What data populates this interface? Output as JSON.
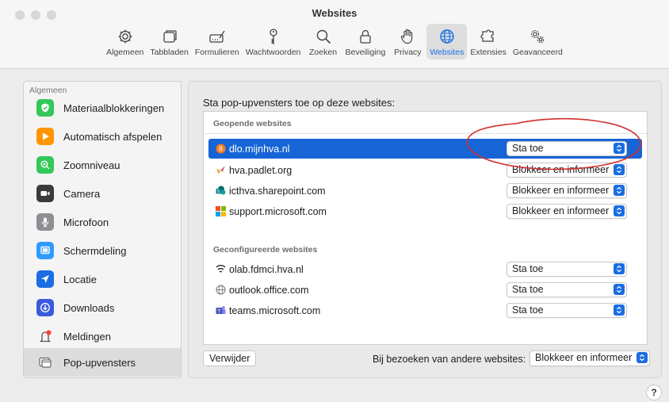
{
  "window": {
    "title": "Websites"
  },
  "toolbar": {
    "items": [
      {
        "label": "Algemeen",
        "icon": "gear-icon"
      },
      {
        "label": "Tabbladen",
        "icon": "tabs-icon"
      },
      {
        "label": "Formulieren",
        "icon": "form-icon"
      },
      {
        "label": "Wachtwoorden",
        "icon": "key-icon"
      },
      {
        "label": "Zoeken",
        "icon": "search-icon"
      },
      {
        "label": "Beveiliging",
        "icon": "lock-icon"
      },
      {
        "label": "Privacy",
        "icon": "hand-icon"
      },
      {
        "label": "Websites",
        "icon": "globe-icon",
        "active": true
      },
      {
        "label": "Extensies",
        "icon": "puzzle-icon"
      },
      {
        "label": "Geavanceerd",
        "icon": "gears-icon"
      }
    ]
  },
  "sidebar": {
    "header": "Algemeen",
    "items": [
      {
        "label": "Materiaalblokkeringen",
        "icon": "content-blocker-icon",
        "color": "#34c759"
      },
      {
        "label": "Automatisch afspelen",
        "icon": "play-icon",
        "color": "#ff9500"
      },
      {
        "label": "Zoomniveau",
        "icon": "zoom-icon",
        "color": "#34c759"
      },
      {
        "label": "Camera",
        "icon": "camera-icon",
        "color": "#3a3a3c"
      },
      {
        "label": "Microfoon",
        "icon": "microphone-icon",
        "color": "#8e8e93"
      },
      {
        "label": "Schermdeling",
        "icon": "screen-share-icon",
        "color": "#2f9bff"
      },
      {
        "label": "Locatie",
        "icon": "location-icon",
        "color": "#1a6de3"
      },
      {
        "label": "Downloads",
        "icon": "download-icon",
        "color": "#3b5bdb"
      },
      {
        "label": "Meldingen",
        "icon": "notification-icon",
        "color": "#ff3b30"
      },
      {
        "label": "Pop-upvensters",
        "icon": "popup-window-icon",
        "color": "#8e8e93",
        "selected": true
      }
    ]
  },
  "main": {
    "heading": "Sta pop-upvensters toe op deze websites:",
    "open_header": "Geopende websites",
    "open_sites": [
      {
        "name": "dlo.mijnhva.nl",
        "setting": "Sta toe",
        "icon": "brightspace-icon",
        "selected": true
      },
      {
        "name": "hva.padlet.org",
        "setting": "Blokkeer en informeer",
        "icon": "padlet-icon"
      },
      {
        "name": "icthva.sharepoint.com",
        "setting": "Blokkeer en informeer",
        "icon": "sharepoint-icon"
      },
      {
        "name": "support.microsoft.com",
        "setting": "Blokkeer en informeer",
        "icon": "microsoft-icon"
      }
    ],
    "configured_header": "Geconfigureerde websites",
    "configured_sites": [
      {
        "name": "olab.fdmci.hva.nl",
        "setting": "Sta toe",
        "icon": "olab-icon"
      },
      {
        "name": "outlook.office.com",
        "setting": "Sta toe",
        "icon": "globe-icon"
      },
      {
        "name": "teams.microsoft.com",
        "setting": "Sta toe",
        "icon": "teams-icon"
      }
    ],
    "remove_button": "Verwijder",
    "other_label": "Bij bezoeken van andere websites:",
    "other_value": "Blokkeer en informeer"
  },
  "help": {
    "label": "?"
  },
  "colors": {
    "accent": "#1a6de3",
    "selection": "#1764d6",
    "annotation": "#d32f2f"
  }
}
